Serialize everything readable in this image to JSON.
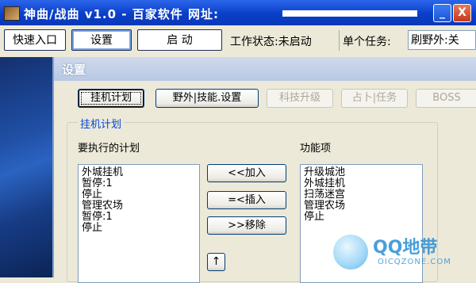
{
  "window": {
    "title": "神曲/战曲  v1.0  - 百家软件   网址:",
    "min_symbol": "_",
    "close_symbol": "X"
  },
  "toolbar": {
    "quick_entry": "快速入口",
    "settings": "设置",
    "start": "启  动",
    "status": "工作状态:未启动",
    "task_label": "单个任务:",
    "task_value": "刷野外:关"
  },
  "dialog": {
    "title": "设置",
    "tabs": [
      {
        "label": "挂机计划",
        "enabled": true
      },
      {
        "label": "野外|技能.设置",
        "enabled": true
      },
      {
        "label": "科技升级",
        "enabled": false
      },
      {
        "label": "占卜|任务",
        "enabled": false
      },
      {
        "label": "BOSS",
        "enabled": false
      }
    ],
    "group_title": "挂机计划",
    "plan_label": "要执行的计划",
    "func_label": "功能项",
    "plan_items": [
      "外城挂机",
      "暂停:1",
      "停止",
      "管理农场",
      "暂停:1",
      "停止"
    ],
    "func_items": [
      "升级城池",
      "外城挂机",
      "扫荡迷宫",
      "管理农场",
      "停止"
    ],
    "buttons": {
      "add": "<<加入",
      "insert": "=<插入",
      "remove": ">>移除",
      "up": "↑"
    }
  },
  "watermark": {
    "brand": "QQ地带",
    "site": "OICQZONE.COM"
  }
}
